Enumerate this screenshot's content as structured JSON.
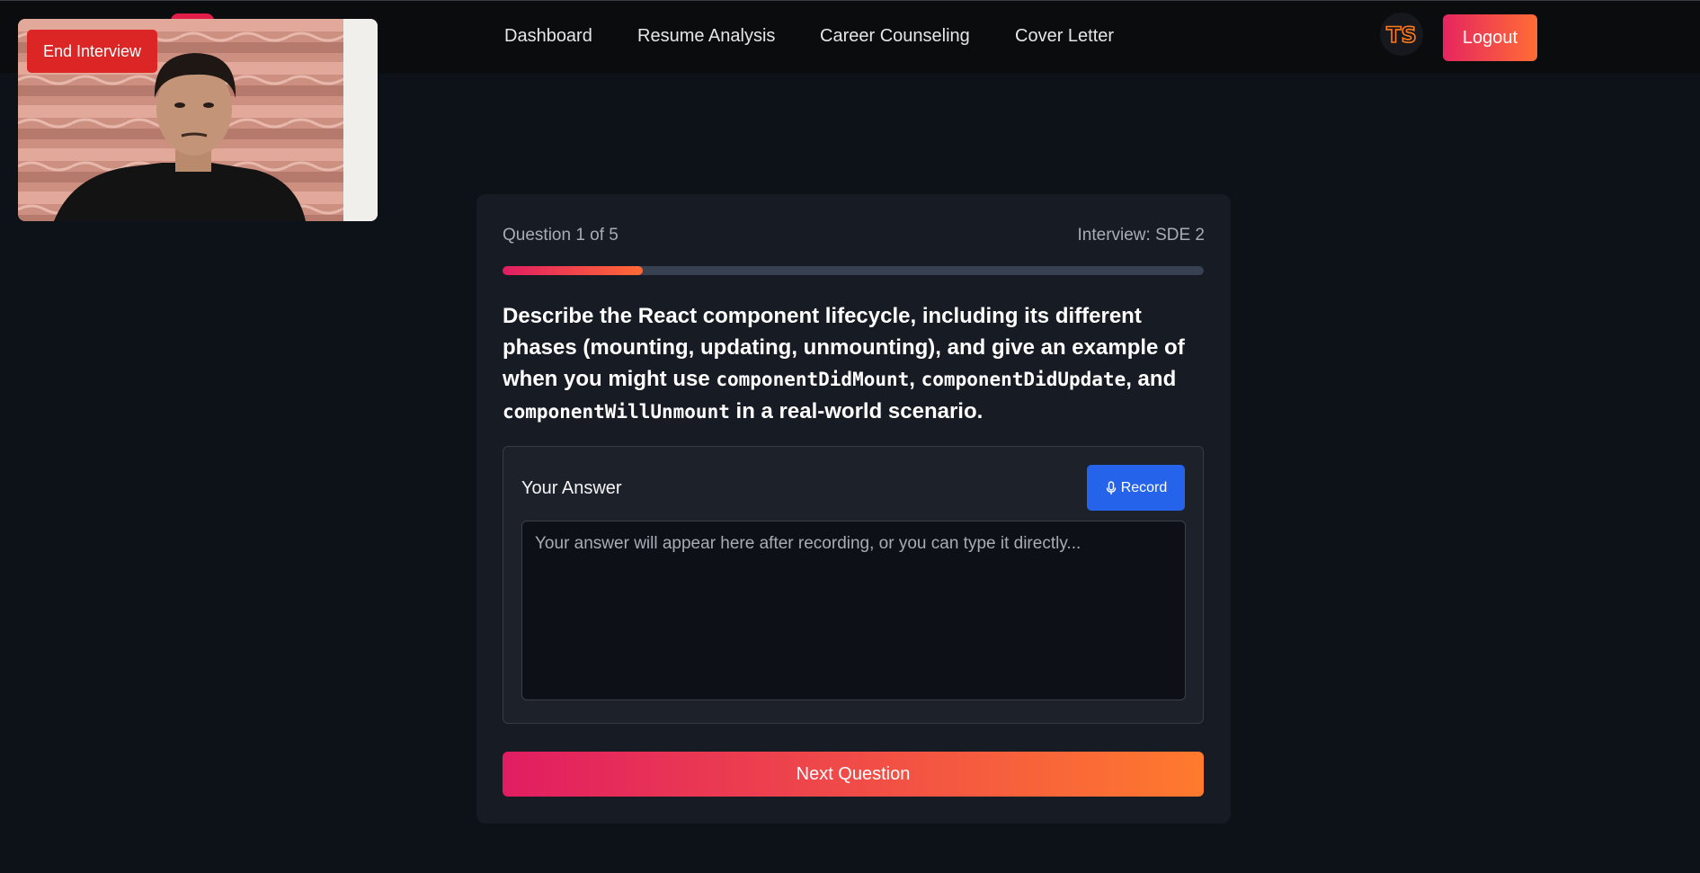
{
  "nav": {
    "items": [
      "Dashboard",
      "Resume Analysis",
      "Career Counseling",
      "Cover Letter"
    ],
    "logout_label": "Logout",
    "avatar_text": "TS"
  },
  "video": {
    "end_label": "End Interview"
  },
  "interview": {
    "question_count": "Question 1 of 5",
    "interview_label": "Interview: SDE 2",
    "progress": 0.2,
    "question_parts": [
      "Describe the React component lifecycle, including its different phases (mounting, updating, unmounting), and give an example of when you might use ",
      "componentDidMount",
      ", ",
      "componentDidUpdate",
      ", and ",
      "componentWillUnmount",
      " in a real-world scenario."
    ]
  },
  "answer": {
    "label": "Your Answer",
    "record_label": "Record",
    "placeholder": "Your answer will appear here after recording, or you can type it directly...",
    "value": ""
  },
  "next_label": "Next Question",
  "colors": {
    "accent_start": "#e11d62",
    "accent_end": "#ff7a2d",
    "record_blue": "#2563eb",
    "end_red": "#dc2626"
  }
}
